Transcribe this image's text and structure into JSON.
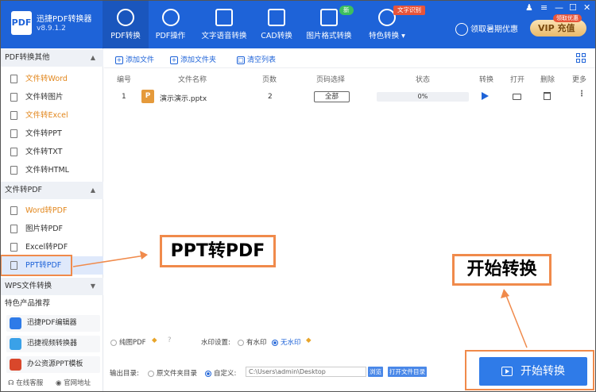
{
  "app": {
    "name": "迅捷PDF转换器",
    "version": "v8.9.1.2",
    "logo": "PDF"
  },
  "nav": [
    {
      "label": "PDF转换",
      "icon": "convert-icon",
      "active": true
    },
    {
      "label": "PDF操作",
      "icon": "gear-icon"
    },
    {
      "label": "文字语音转换",
      "icon": "audio-wave-icon"
    },
    {
      "label": "CAD转换",
      "icon": "cad-icon"
    },
    {
      "label": "图片格式转换",
      "icon": "image-icon"
    },
    {
      "label": "特色转换",
      "icon": "star-icon"
    }
  ],
  "badges": {
    "new": "新",
    "ocr": "文字识别",
    "vip_tag": "领取优惠"
  },
  "header_right": {
    "login": "领取暑期优惠",
    "vip": "VIP 充值"
  },
  "sidebar": {
    "sec1": "PDF转换其他",
    "sec1_items": [
      "文件转Word",
      "文件转图片",
      "文件转Excel",
      "文件转PPT",
      "文件转TXT",
      "文件转HTML"
    ],
    "sec2": "文件转PDF",
    "sec2_items": [
      "Word转PDF",
      "图片转PDF",
      "Excel转PDF",
      "PPT转PDF"
    ],
    "sec3": "WPS文件转换",
    "sec4": "特色产品推荐",
    "products": [
      "迅捷PDF编辑器",
      "迅捷视频转换器",
      "办公资源PPT模板"
    ],
    "footer": [
      "在线客服",
      "官网地址"
    ]
  },
  "toolbar": {
    "add_file": "添加文件",
    "add_folder": "添加文件夹",
    "clear": "清空列表"
  },
  "table": {
    "headers": [
      "编号",
      "文件名称",
      "页数",
      "页码选择",
      "状态",
      "转换",
      "打开",
      "删除",
      "更多"
    ],
    "rows": [
      {
        "num": "1",
        "name": "演示演示.pptx",
        "pages": "2",
        "range": "全部",
        "status": "0%"
      }
    ]
  },
  "options": {
    "pure_pdf": "纯图PDF",
    "watermark_label": "水印设置:",
    "with_wm": "有水印",
    "no_wm": "无水印"
  },
  "output": {
    "label": "输出目录:",
    "orig": "原文件夹目录",
    "custom": "自定义:",
    "path": "C:\\Users\\admin\\Desktop",
    "browse": "浏览",
    "open": "打开文件目录"
  },
  "start_button": "开始转换",
  "callouts": {
    "ppt": "PPT转PDF",
    "start": "开始转换"
  },
  "colors": {
    "brand": "#1e63d8",
    "accent": "#f08a4b"
  }
}
